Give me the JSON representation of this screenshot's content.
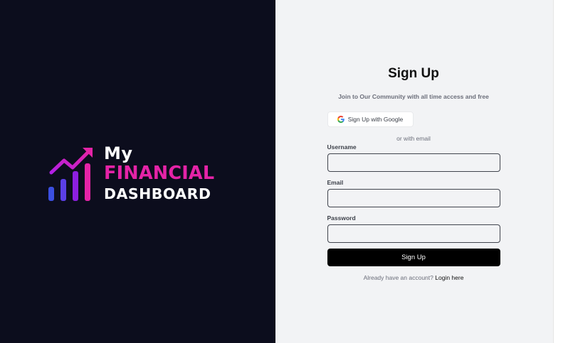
{
  "logo": {
    "line1": "My",
    "line2": "FINANCIAL",
    "line3": "DASHBOARD",
    "colors": {
      "accent": "#e523a7",
      "bar_blue": "#3b4fe0",
      "bar_purple": "#8d1fe0",
      "bar_pink": "#e523a7"
    }
  },
  "form": {
    "title": "Sign Up",
    "subtitle": "Join to Our Community with all time access and free",
    "google_button_label": "Sign Up with Google",
    "divider_text": "or with email",
    "fields": [
      {
        "label": "Username",
        "value": "",
        "placeholder": ""
      },
      {
        "label": "Email",
        "value": "",
        "placeholder": ""
      },
      {
        "label": "Password",
        "value": "",
        "placeholder": ""
      }
    ],
    "submit_label": "Sign Up",
    "login_prompt": "Already have an account?",
    "login_link": "Login here"
  },
  "colors": {
    "left_bg": "#0c0d1d",
    "right_bg": "#f2f3f5",
    "button_bg": "#000000"
  }
}
